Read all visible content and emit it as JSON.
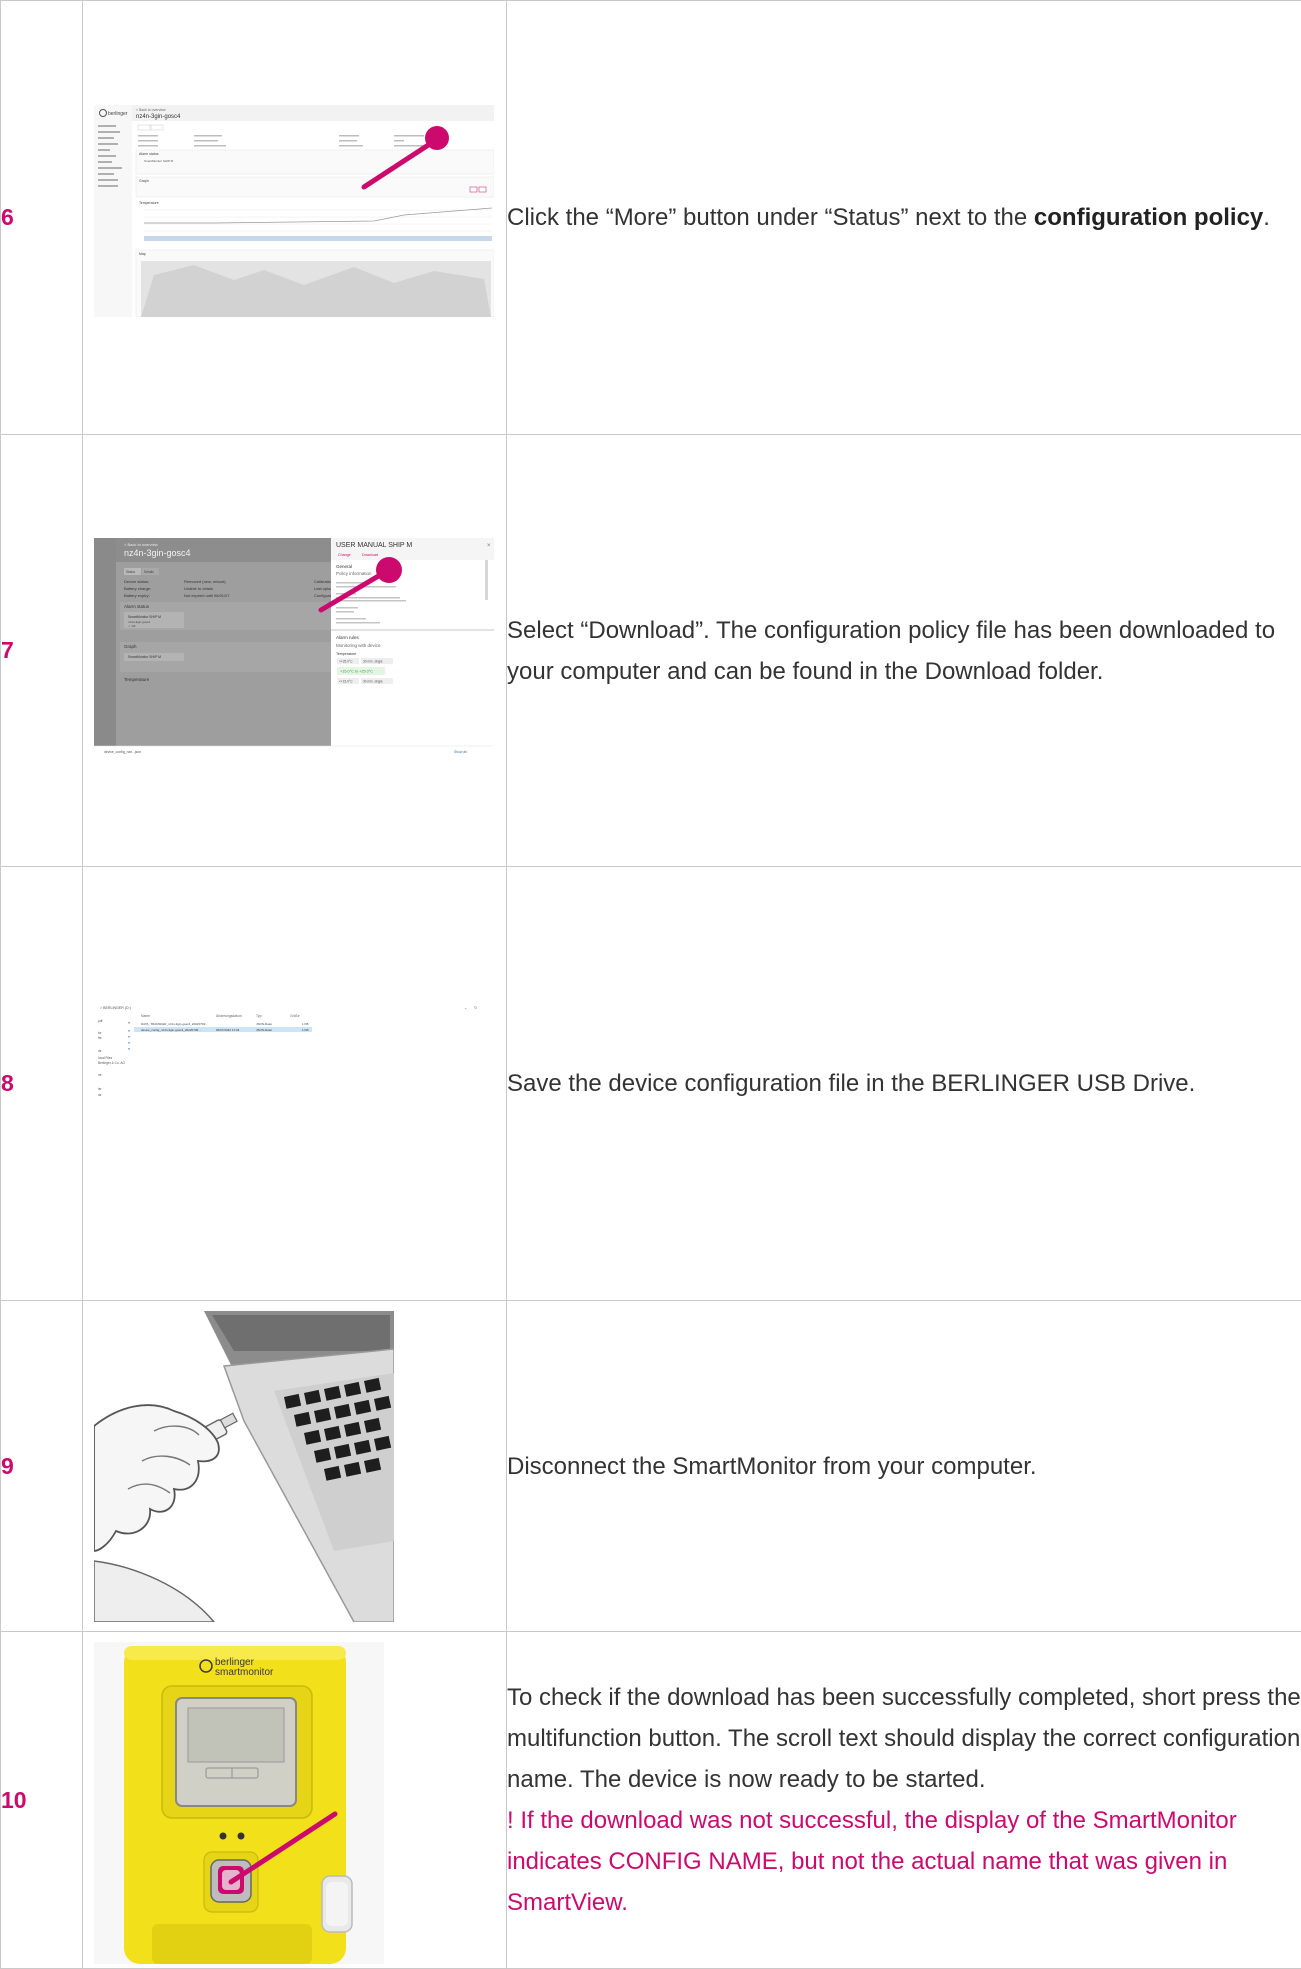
{
  "steps": [
    {
      "number": "6",
      "text_before": "Click the “More” button under “Status” next to the ",
      "text_bold": "configuration policy",
      "text_after": ".",
      "screenshot": {
        "device_title": "nz4n-3gin-gosc4",
        "back_link": "< Back to overview",
        "tabs": [
          "Status",
          "Details"
        ],
        "section_alarm": "Alarm status",
        "device_item": "SmartMonitor SHIP M",
        "section_graph": "Graph",
        "section_temperature": "Temperature",
        "section_map": "Map"
      }
    },
    {
      "number": "7",
      "text": "Select “Download”. The configuration policy file has been downloaded to your computer and can be found in the Download folder.",
      "screenshot": {
        "back_link": "< Back to overview",
        "device_title": "nz4n-3gin-gosc4",
        "tabs": [
          "Status",
          "Details"
        ],
        "rows": [
          {
            "label": "Device status:",
            "value": "Removed (new, reboot)"
          },
          {
            "label": "Battery charge:",
            "value": "Unable to obtain"
          },
          {
            "label": "Battery expiry:",
            "value": "Not expired until 06/01/27"
          }
        ],
        "right_labels": [
          "Calibratio",
          "Last uploa",
          "Configurat"
        ],
        "section_alarm": "Alarm status",
        "device_item": "SmartMonitor SHIP M",
        "device_sub": "nz4n-3gin-gosc4",
        "device_ok": "✓ OK",
        "section_graph": "Graph",
        "section_temperature": "Temperature",
        "panel_title": "USER MANUAL SHIP M",
        "panel_actions": [
          "Change",
          "Download"
        ],
        "panel_general": "General",
        "panel_policy": "Policy information",
        "panel_alarm_rules": "Alarm rules",
        "panel_monitoring": "Monitoring with device",
        "panel_temperature": "Temperature",
        "ranges": [
          ">+25.0°C",
          "+15.0°C to +25.0°C",
          "<+15.0°C"
        ],
        "delays": [
          "30 min. single",
          "30 min. single"
        ],
        "download_file": "device_config_nzn...json",
        "show_all": "Show all"
      }
    },
    {
      "number": "8",
      "text": "Save the device configuration file in the BERLINGER USB Drive.",
      "screenshot": {
        "path": "> BERLINGER (D:)",
        "columns": [
          "Name",
          "Änderungsdatum",
          "Typ",
          "Größe"
        ],
        "files": [
          {
            "name": "DATA_TRANSFER_nz4n-3gin-gosc4_20220703...",
            "date": "",
            "type": "JSON-Datei",
            "size": "1 KB"
          },
          {
            "name": "device_config_nz4n-3gin-gosc4_20220706...",
            "date": "06/07/2022 17:04",
            "type": "JSON-Datei",
            "size": "1 KB"
          }
        ],
        "sidebar": [
          "pdf",
          "ke",
          "fte",
          "ds",
          "local Files",
          "Berlinger & Co. AG",
          "ne",
          "ler",
          "ds"
        ]
      }
    },
    {
      "number": "9",
      "text": "Disconnect the SmartMonitor from your computer."
    },
    {
      "number": "10",
      "text": "To check if the download has been successfully completed, short press the multifunction button. The scroll text should display the correct configuration name. The device is now ready to be started.",
      "warning": "! If the download was not successful, the display of the SmartMonitor indicates CONFIG NAME, but not the actual name that was given in SmartView.",
      "device": {
        "brand": "berlinger",
        "product": "smartmonitor"
      }
    }
  ],
  "colors": {
    "accent": "#cc0a6e",
    "border": "#c9c9c9",
    "text": "#333333",
    "device_yellow": "#f2e01a"
  }
}
